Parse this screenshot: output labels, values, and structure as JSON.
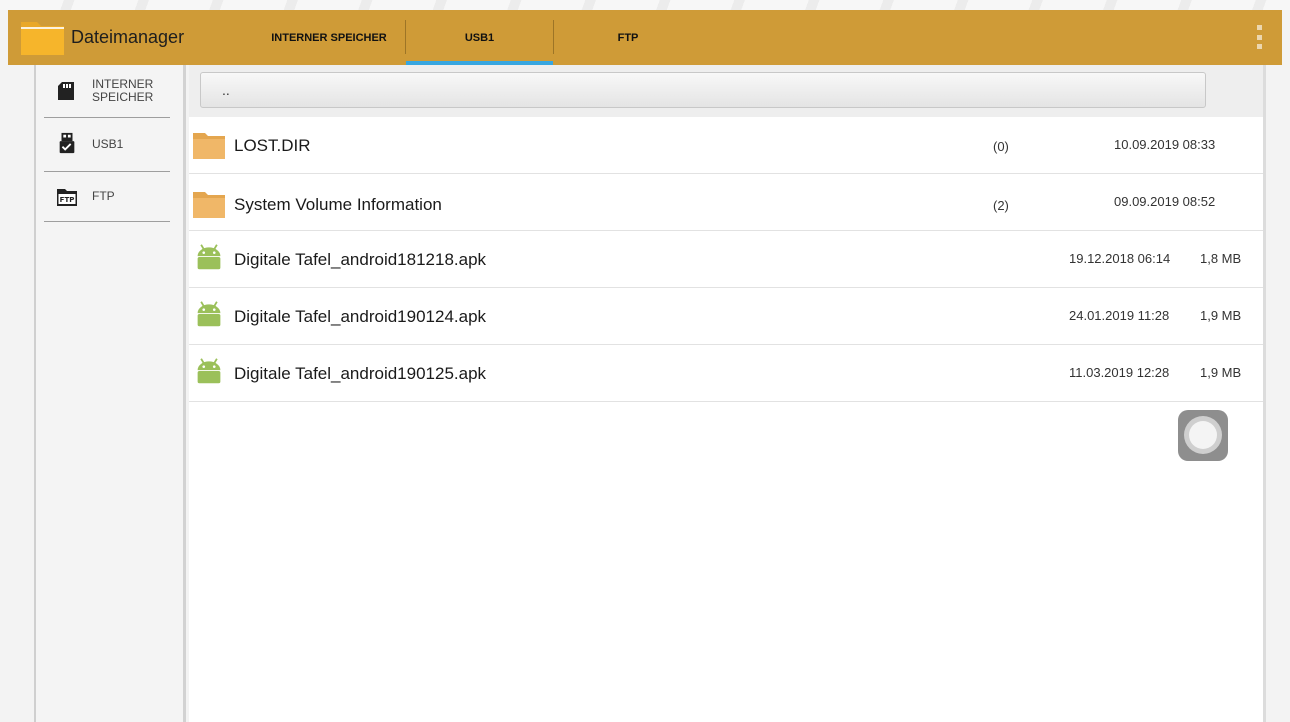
{
  "app": {
    "title": "Dateimanager",
    "icon": "folder-icon",
    "accent_color": "#cf9b37",
    "tab_indicator_color": "#37a6e0"
  },
  "tabs": [
    {
      "label": "INTERNER SPEICHER",
      "active": false
    },
    {
      "label": "USB1",
      "active": true
    },
    {
      "label": "FTP",
      "active": false
    }
  ],
  "sidebar": {
    "items": [
      {
        "label_line1": "INTERNER",
        "label_line2": "SPEICHER",
        "icon": "sd-card-icon"
      },
      {
        "label": "USB1",
        "icon": "usb-drive-icon"
      },
      {
        "label": "FTP",
        "icon": "ftp-icon"
      }
    ]
  },
  "parent_dir": {
    "label": ".."
  },
  "files": [
    {
      "name": "LOST.DIR",
      "type": "folder",
      "count": "(0)",
      "date": "10.09.2019 08:33",
      "size": ""
    },
    {
      "name": "System Volume Information",
      "type": "folder",
      "count": "(2)",
      "date": "09.09.2019 08:52",
      "size": ""
    },
    {
      "name": "Digitale Tafel_android181218.apk",
      "type": "apk",
      "count": "",
      "date": "19.12.2018 06:14",
      "size": "1,8 MB"
    },
    {
      "name": "Digitale Tafel_android190124.apk",
      "type": "apk",
      "count": "",
      "date": "24.01.2019 11:28",
      "size": "1,9 MB"
    },
    {
      "name": "Digitale Tafel_android190125.apk",
      "type": "apk",
      "count": "",
      "date": "11.03.2019 12:28",
      "size": "1,9 MB"
    }
  ]
}
